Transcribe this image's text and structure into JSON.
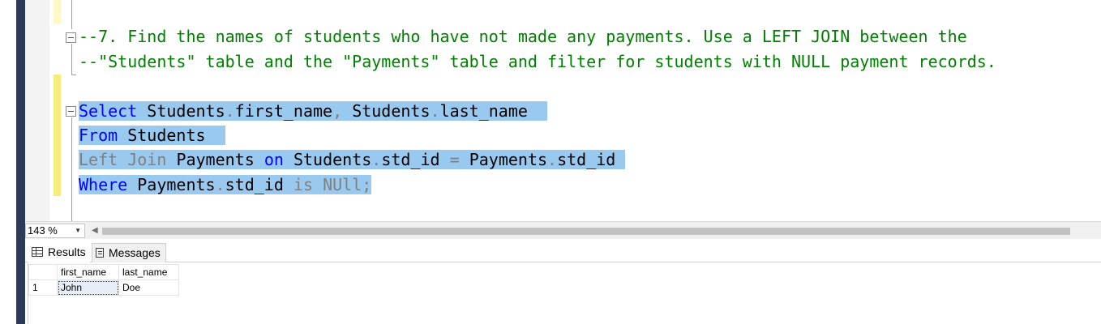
{
  "editor": {
    "comment_line_1": "--7. Find the names of students who have not made any payments. Use a LEFT JOIN between the",
    "comment_line_2": "--\"Students\" table and the \"Payments\" table and filter for students with NULL payment records.",
    "query": {
      "line1": {
        "kw": "Select",
        "a": "Students",
        "dot1": ".",
        "b": "first_name",
        "comma": ",",
        "c": "Students",
        "dot2": ".",
        "d": "last_name"
      },
      "line2": {
        "kw": "From",
        "a": "Students"
      },
      "line3": {
        "kw1": "Left",
        "kw2": "Join",
        "a": "Payments",
        "on": "on",
        "b": "Students",
        "dot1": ".",
        "c": "std_id",
        "eq": "=",
        "d": "Payments",
        "dot2": ".",
        "e": "std_id"
      },
      "line4": {
        "kw": "Where",
        "a": "Payments",
        "dot": ".",
        "b": "std_id",
        "is": "is",
        "null": "NUll",
        "semi": ";"
      }
    }
  },
  "zoom": {
    "value": "143 %"
  },
  "tabs": [
    {
      "label": "Results",
      "icon": "grid-icon"
    },
    {
      "label": "Messages",
      "icon": "messages-icon"
    }
  ],
  "results": {
    "columns": [
      "first_name",
      "last_name"
    ],
    "rows": [
      {
        "num": "1",
        "first_name": "John",
        "last_name": "Doe"
      }
    ]
  },
  "colors": {
    "comment": "#008000",
    "keyword": "#0000ff",
    "operator": "#808080",
    "selection": "#99c9ef",
    "frame": "#2d3a57"
  }
}
